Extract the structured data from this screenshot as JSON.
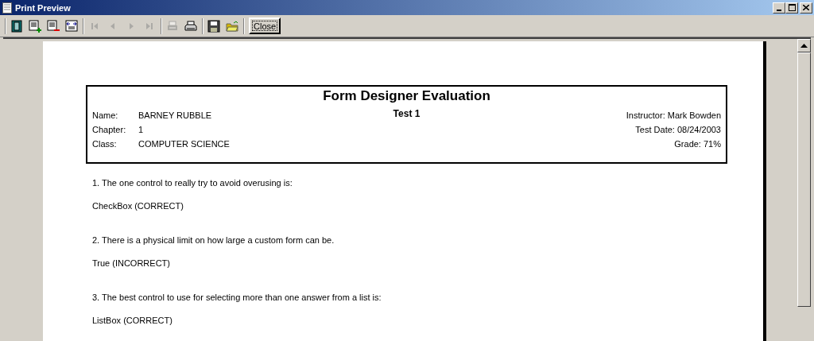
{
  "window": {
    "title": "Print Preview"
  },
  "toolbar": {
    "groups": [
      [
        {
          "kind": "one-page",
          "disabled": false
        },
        {
          "kind": "zoom-in",
          "disabled": false
        },
        {
          "kind": "zoom-out",
          "disabled": false
        },
        {
          "kind": "page-width",
          "disabled": false
        }
      ],
      [
        {
          "kind": "first",
          "disabled": true
        },
        {
          "kind": "prev",
          "disabled": true
        },
        {
          "kind": "next",
          "disabled": true
        },
        {
          "kind": "last",
          "disabled": true
        }
      ],
      [
        {
          "kind": "print-setup",
          "disabled": true
        },
        {
          "kind": "print",
          "disabled": false
        }
      ],
      [
        {
          "kind": "save",
          "disabled": false
        },
        {
          "kind": "open",
          "disabled": false
        }
      ],
      [
        {
          "kind": "close",
          "label": "Close",
          "disabled": false
        }
      ]
    ]
  },
  "report": {
    "title": "Form Designer Evaluation",
    "subtitle": "Test 1",
    "fields_left": [
      {
        "label": "Name:",
        "value": "BARNEY RUBBLE"
      },
      {
        "label": "Chapter:",
        "value": "1"
      },
      {
        "label": "Class:",
        "value": "COMPUTER SCIENCE"
      }
    ],
    "fields_right": [
      "Instructor: Mark Bowden",
      "Test Date: 08/24/2003",
      "Grade: 71%"
    ],
    "questions": [
      {
        "question": "1. The one control to really try to avoid overusing is:",
        "answer": "CheckBox (CORRECT)"
      },
      {
        "question": "2. There is a physical limit on how large a custom form can be.",
        "answer": "True (INCORRECT)"
      },
      {
        "question": "3. The best control to use for selecting more than one answer from a list is:",
        "answer": "ListBox (CORRECT)"
      }
    ]
  }
}
